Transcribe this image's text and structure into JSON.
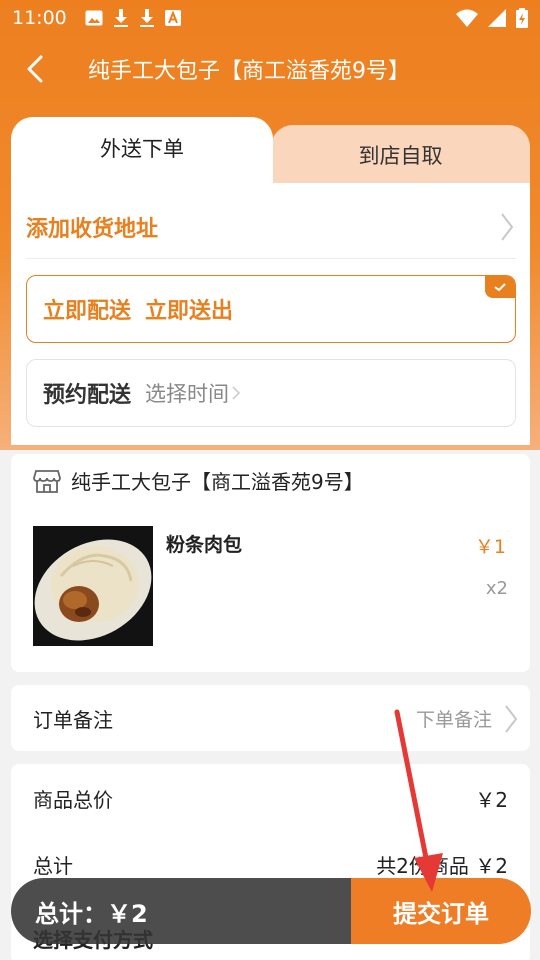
{
  "status_bar": {
    "time": "11:00",
    "left_icons": [
      "image-icon",
      "download-icon",
      "download-icon",
      "a-icon"
    ],
    "right_icons": [
      "wifi-icon",
      "signal-icon",
      "battery-icon"
    ]
  },
  "nav": {
    "title": "纯手工大包子【商工溢香苑9号】"
  },
  "tabs": [
    {
      "label": "外送下单",
      "active": true
    },
    {
      "label": "到店自取",
      "active": false
    }
  ],
  "delivery": {
    "address_label": "添加收货地址",
    "immediate": {
      "label": "立即配送",
      "value": "立即送出",
      "selected": true
    },
    "scheduled": {
      "label": "预约配送",
      "value": "选择时间",
      "selected": false
    }
  },
  "store": {
    "name": "纯手工大包子【商工溢香苑9号】",
    "items": [
      {
        "name": "粉条肉包",
        "price": "￥1",
        "qty": "x2"
      }
    ]
  },
  "note": {
    "label": "订单备注",
    "hint": "下单备注"
  },
  "summary": {
    "goods_total_label": "商品总价",
    "goods_total_value": "￥2",
    "total_label": "总计",
    "total_value": "共2份商品 ￥2",
    "payment_label": "选择支付方式"
  },
  "bottom_bar": {
    "total_text": "总计：￥2",
    "submit_label": "提交订单"
  },
  "colors": {
    "accent": "#e8801f",
    "header": "#ed7f1f",
    "tab_inactive": "#fad6bd",
    "annotation_arrow": "#e53935"
  }
}
